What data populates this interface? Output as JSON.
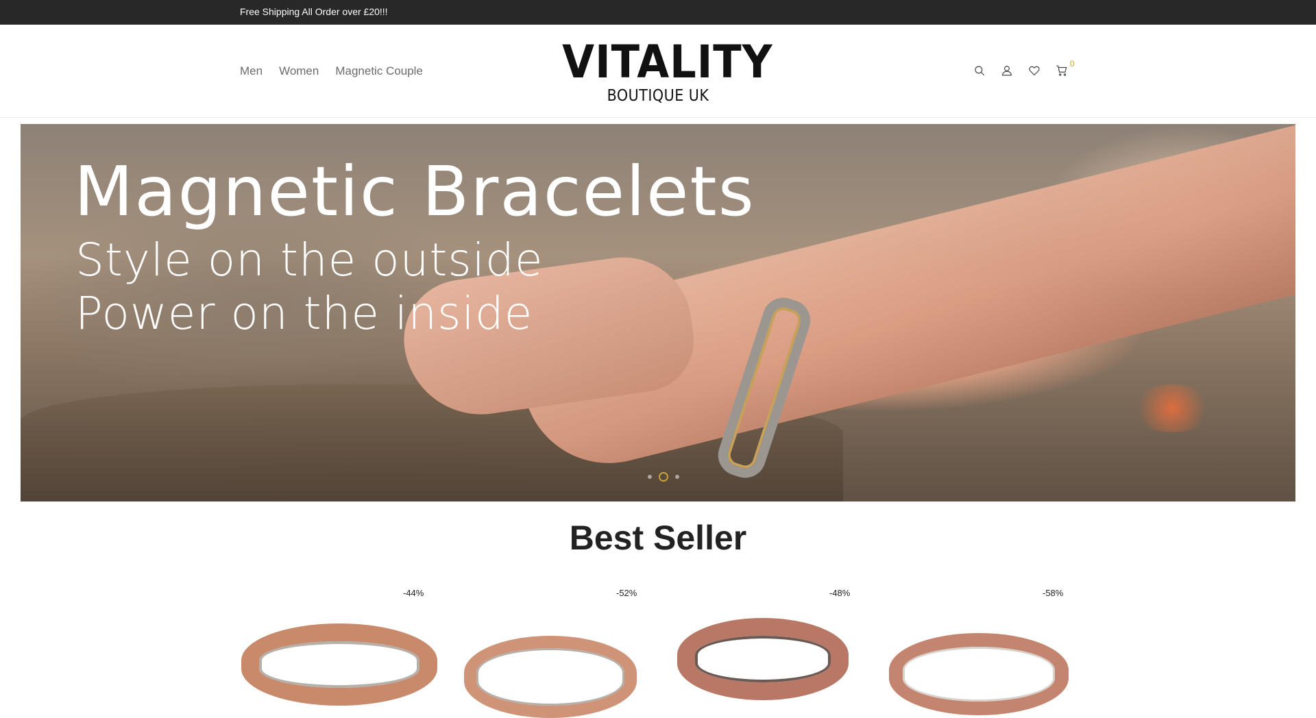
{
  "topbar": {
    "text": "Free Shipping All Order over £20!!!"
  },
  "nav": {
    "items": [
      "Men",
      "Women",
      "Magnetic Couple"
    ]
  },
  "logo": {
    "main": "VITALITY",
    "sub": "BOUTIQUE UK"
  },
  "header_icons": [
    "search-icon",
    "user-icon",
    "heart-icon",
    "cart-icon"
  ],
  "cart": {
    "count": "0"
  },
  "hero": {
    "title": "Magnetic Bracelets",
    "line1": "Style on the outside",
    "line2": "Power on the inside",
    "slide_count": 3,
    "active_slide": 2
  },
  "best_seller": {
    "title": "Best Seller",
    "products": [
      {
        "discount": "-44%"
      },
      {
        "discount": "-52%"
      },
      {
        "discount": "-48%"
      },
      {
        "discount": "-58%"
      }
    ]
  },
  "colors": {
    "topbar": "#282828",
    "accent": "#c8a13a",
    "nav_text": "#6b6b6b",
    "copper": "#c98a6b"
  }
}
